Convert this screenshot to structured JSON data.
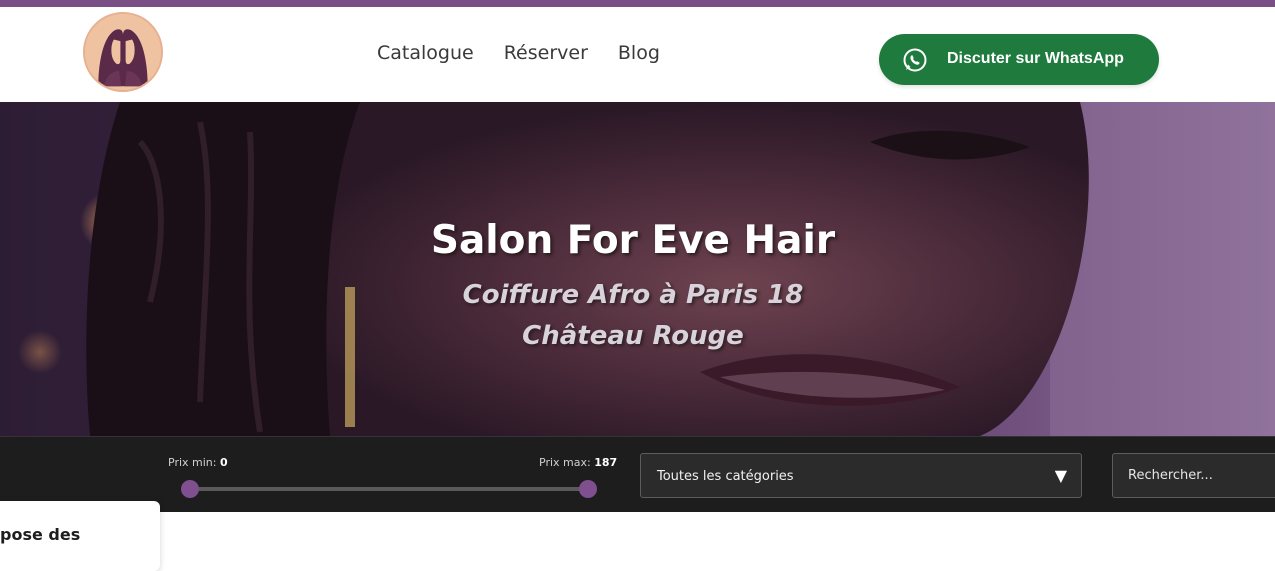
{
  "colors": {
    "accent": "#7a4f86",
    "whatsapp_green": "#1f7a3e",
    "filter_bg": "#1d1d1d",
    "slider_handle": "#7f4f8f"
  },
  "header": {
    "logo_icon": "salon-logo-two-women-icon",
    "nav": [
      {
        "label": "Catalogue"
      },
      {
        "label": "Réserver"
      },
      {
        "label": "Blog"
      }
    ],
    "whatsapp_button": {
      "icon": "whatsapp-icon",
      "label": "Discuter sur WhatsApp"
    }
  },
  "hero": {
    "title": "Salon For Eve Hair",
    "subtitle_line1": "Coiffure Afro à Paris 18",
    "subtitle_line2": "Château Rouge"
  },
  "filters": {
    "price_min_label": "Prix min:",
    "price_min_value": "0",
    "price_max_label": "Prix max:",
    "price_max_value": "187",
    "category_selected": "Toutes les catégories",
    "category_caret_icon": "triangle-down-icon",
    "search_placeholder": "Rechercher..."
  },
  "content": {
    "card_text": "pose des"
  }
}
